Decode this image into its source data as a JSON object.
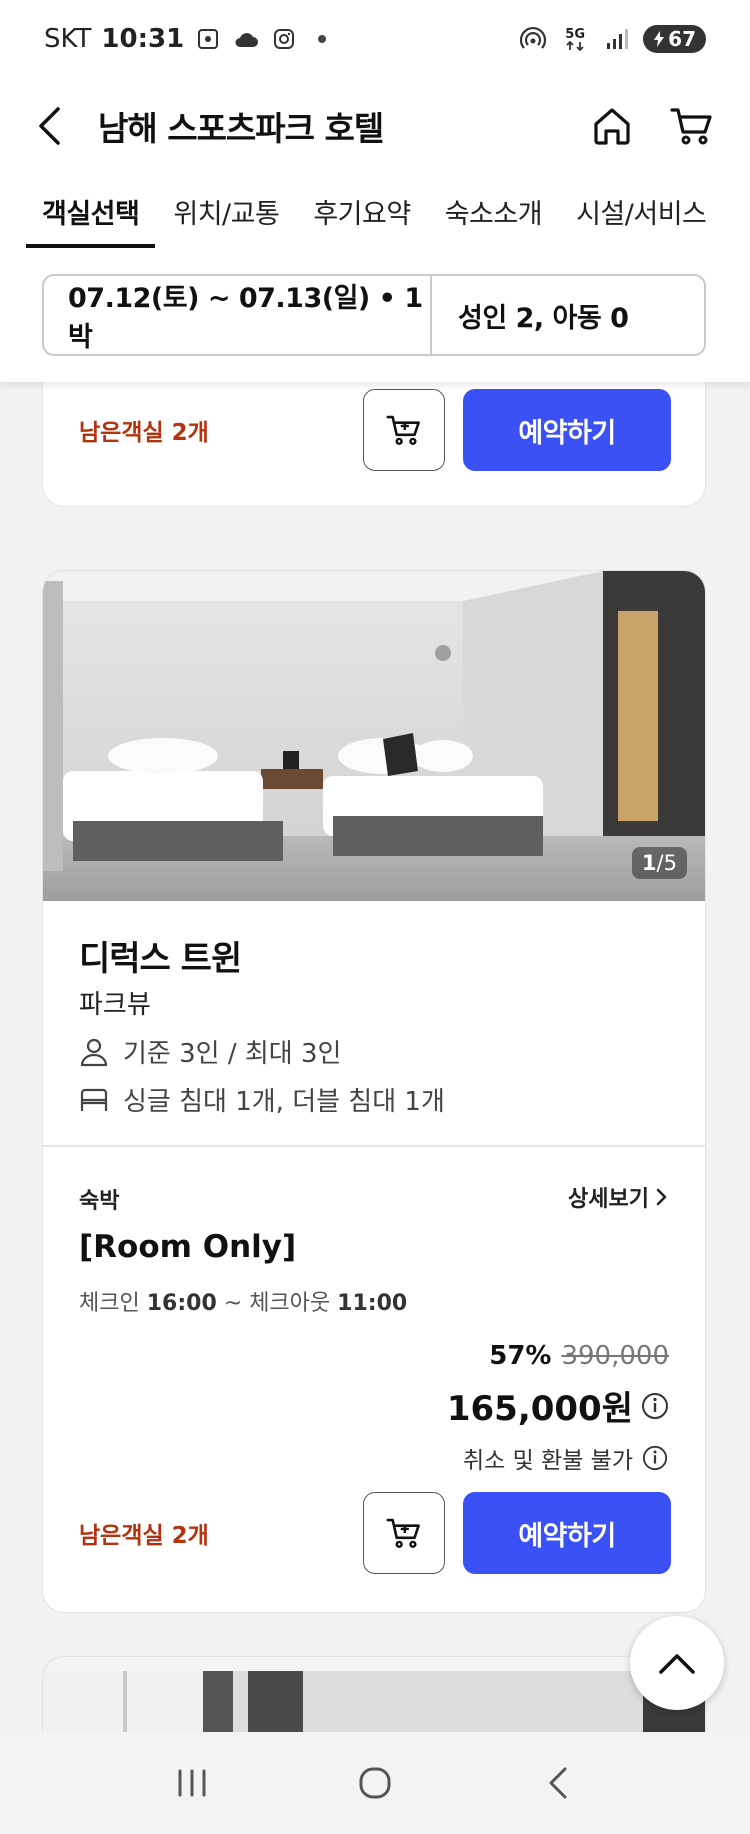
{
  "status_bar": {
    "carrier": "SKT",
    "time": "10:31",
    "battery": "67",
    "network": "5G"
  },
  "header": {
    "title": "남해 스포츠파크 호텔"
  },
  "tabs": [
    {
      "label": "객실선택",
      "active": true
    },
    {
      "label": "위치/교통",
      "active": false
    },
    {
      "label": "후기요약",
      "active": false
    },
    {
      "label": "숙소소개",
      "active": false
    },
    {
      "label": "시설/서비스",
      "active": false
    }
  ],
  "date_bar": {
    "dates": "07.12(토) ~ 07.13(일) • 1박",
    "guests": "성인 2, 아동 0"
  },
  "prev_card": {
    "remaining": "남은객실 2개",
    "reserve_label": "예약하기"
  },
  "room_card": {
    "photo_counter": "1/5",
    "photo_current": "1",
    "photo_total": "5",
    "name": "디럭스 트윈",
    "view": "파크뷰",
    "capacity": "기준 3인 / 최대 3인",
    "beds": "싱글 침대 1개, 더블 침대 1개",
    "plan": {
      "type": "숙박",
      "detail_label": "상세보기",
      "name": "[Room Only]",
      "checkin_label": "체크인",
      "checkin_time": "16:00",
      "checkout_label": "~ 체크아웃",
      "checkout_time": "11:00",
      "discount": "57%",
      "original_price": "390,000",
      "final_price": "165,000원",
      "refund_policy": "취소 및 환불 불가"
    },
    "remaining": "남은객실 2개",
    "reserve_label": "예약하기"
  },
  "colors": {
    "accent": "#3a51f5",
    "remaining": "#b3330f"
  }
}
